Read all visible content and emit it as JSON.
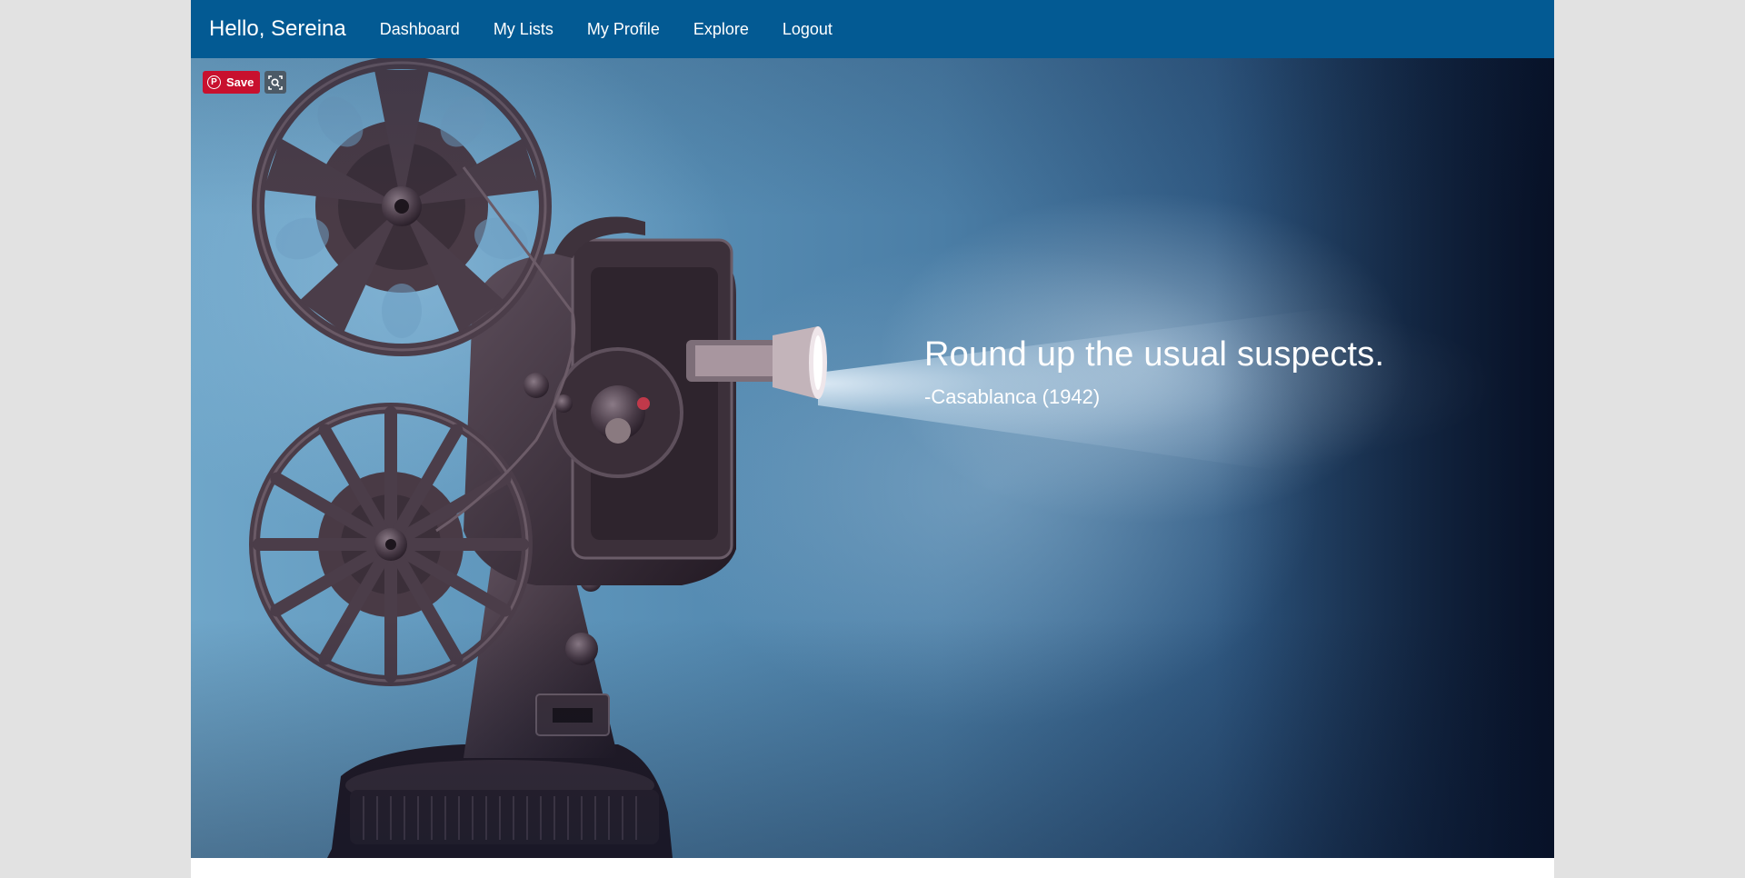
{
  "navbar": {
    "brand": "Hello, Sereina",
    "links": [
      "Dashboard",
      "My Lists",
      "My Profile",
      "Explore",
      "Logout"
    ],
    "background": "#035a93"
  },
  "hero": {
    "quote": "Round up the usual suspects.",
    "source": "-Casablanca (1942)",
    "image_subject": "vintage film projector with light beam"
  },
  "pinterest": {
    "save_label": "Save",
    "save_color": "#c8102e",
    "icons": [
      "pinterest-logo-icon",
      "visual-search-icon"
    ]
  }
}
